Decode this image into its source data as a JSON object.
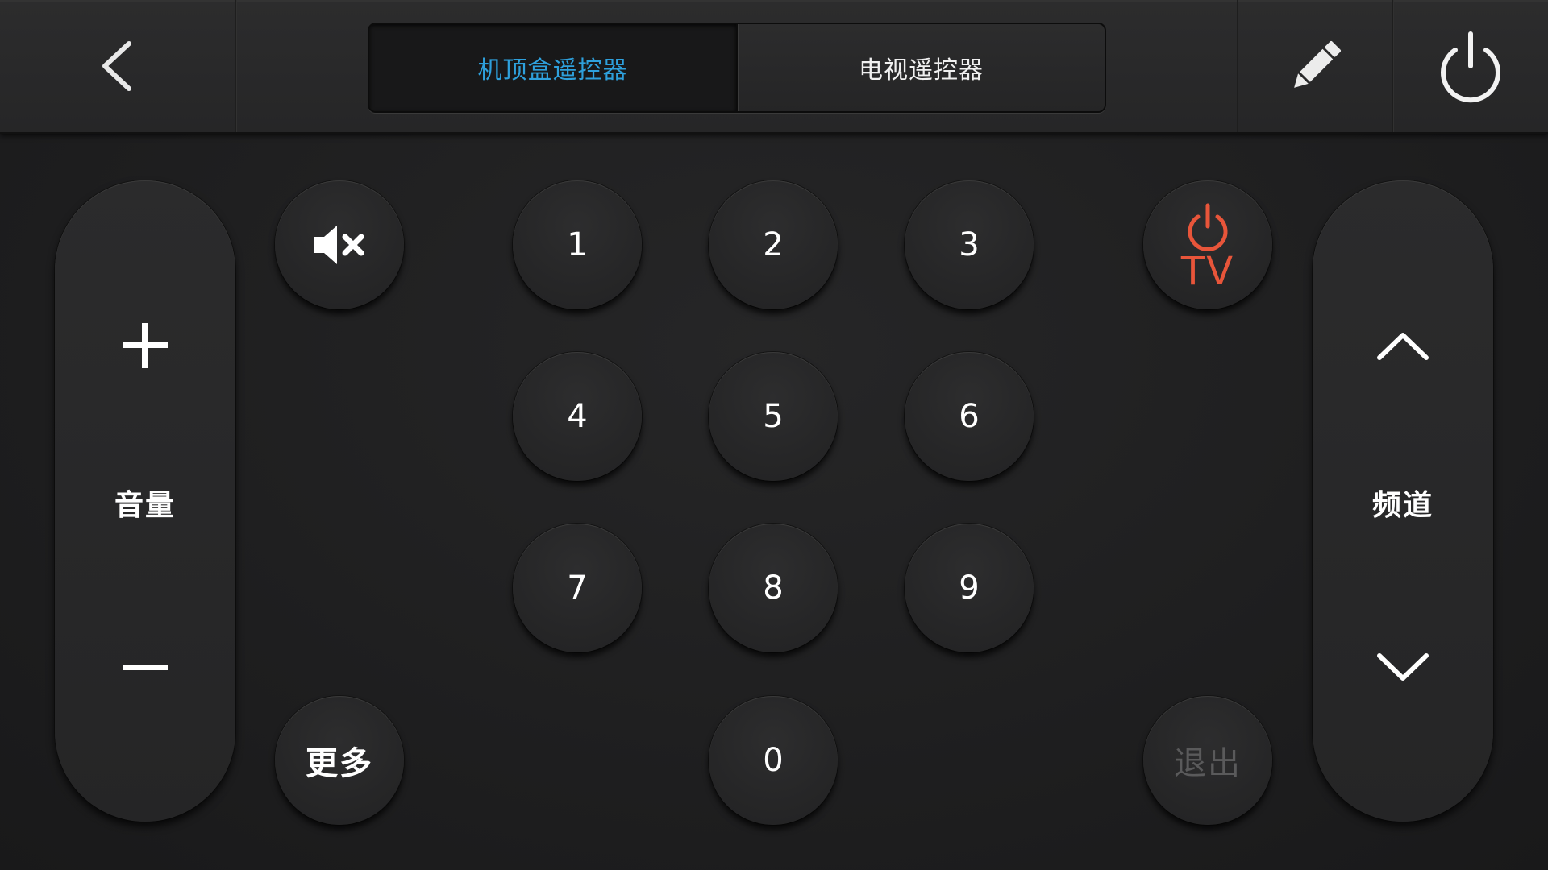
{
  "header": {
    "tabs": [
      {
        "label": "机顶盒遥控器",
        "active": true
      },
      {
        "label": "电视遥控器",
        "active": false
      }
    ],
    "icons": {
      "back": "chevron-left-icon",
      "edit": "pencil-icon",
      "power": "power-icon"
    }
  },
  "volume": {
    "label": "音量",
    "up_icon": "plus-icon",
    "down_icon": "minus-icon"
  },
  "channel": {
    "label": "频道",
    "up_icon": "chevron-up-icon",
    "down_icon": "chevron-down-icon"
  },
  "mute": {
    "icon": "mute-icon"
  },
  "more_label": "更多",
  "exit_label": "退出",
  "tv_power": {
    "label": "TV",
    "icon": "power-icon"
  },
  "keypad": {
    "k1": "1",
    "k2": "2",
    "k3": "3",
    "k4": "4",
    "k5": "5",
    "k6": "6",
    "k7": "7",
    "k8": "8",
    "k9": "9",
    "k0": "0"
  },
  "colors": {
    "accent_active_tab": "#2ea0dc",
    "tv_power": "#e8553a",
    "exit_disabled": "#5a5a5b"
  }
}
